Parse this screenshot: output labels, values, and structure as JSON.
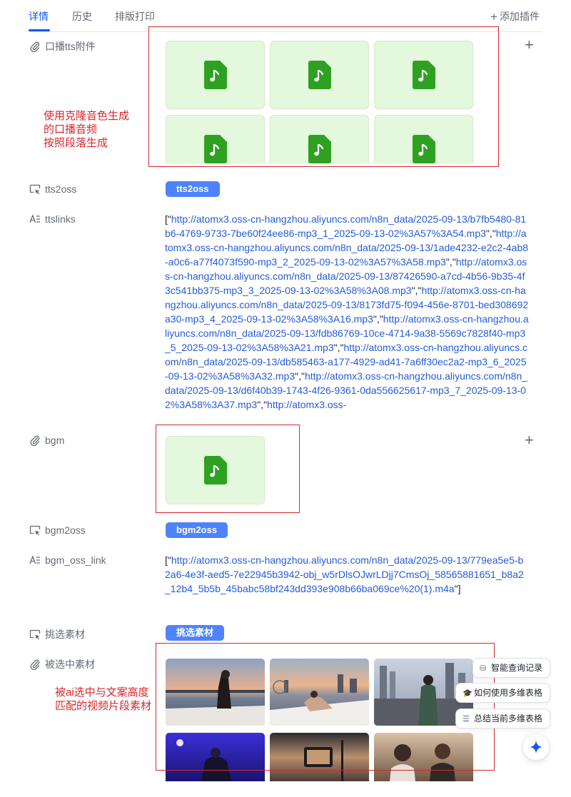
{
  "tabs": {
    "details": "详情",
    "history": "历史",
    "print": "排版打印"
  },
  "add_plugin": "添加插件",
  "fields": {
    "tts_attach": "口播tts附件",
    "tts2oss": "tts2oss",
    "ttslinks": "ttslinks",
    "bgm": "bgm",
    "bgm2oss": "bgm2oss",
    "bgm_oss_link": "bgm_oss_link",
    "select_material": "挑选素材",
    "selected_material": "被选中素材"
  },
  "buttons": {
    "tts2oss": "tts2oss",
    "bgm2oss": "bgm2oss",
    "select_material": "挑选素材"
  },
  "annotations": {
    "tts": [
      "使用克隆音色生成",
      "的口播音频",
      "按照段落生成"
    ],
    "material": [
      "被ai选中与文案高度",
      "匹配的视频片段素材"
    ]
  },
  "ttslinks": {
    "open": "[\"",
    "links": [
      "http://atomx3.oss-cn-hangzhou.aliyuncs.com/n8n_data/2025-09-13/b7fb5480-81b6-4769-9733-7be60f24ee86-mp3_1_2025-09-13-02%3A57%3A54.mp3",
      "http://atomx3.oss-cn-hangzhou.aliyuncs.com/n8n_data/2025-09-13/1ade4232-e2c2-4ab8-a0c6-a77f4073f590-mp3_2_2025-09-13-02%3A57%3A58.mp3",
      "http://atomx3.oss-cn-hangzhou.aliyuncs.com/n8n_data/2025-09-13/87426590-a7cd-4b56-9b35-4f3c541bb375-mp3_3_2025-09-13-02%3A58%3A08.mp3",
      "http://atomx3.oss-cn-hangzhou.aliyuncs.com/n8n_data/2025-09-13/8173fd75-f094-456e-8701-bed308692a30-mp3_4_2025-09-13-02%3A58%3A16.mp3",
      "http://atomx3.oss-cn-hangzhou.aliyuncs.com/n8n_data/2025-09-13/fdb86769-10ce-4714-9a38-5569c7828f40-mp3_5_2025-09-13-02%3A58%3A21.mp3",
      "http://atomx3.oss-cn-hangzhou.aliyuncs.com/n8n_data/2025-09-13/db585463-a177-4929-ad41-7a6ff30ec2a2-mp3_6_2025-09-13-02%3A58%3A32.mp3",
      "http://atomx3.oss-cn-hangzhou.aliyuncs.com/n8n_data/2025-09-13/d6f40b39-1743-4f26-9361-0da556625617-mp3_7_2025-09-13-02%3A58%3A37.mp3",
      "http://atomx3.oss-"
    ],
    "sep": "\",\""
  },
  "bgm_link": {
    "open": "[\"",
    "url": "http://atomx3.oss-cn-hangzhou.aliyuncs.com/n8n_data/2025-09-13/779ea5e5-b2a6-4e3f-aed5-7e22945b3942-obj_w5rDlsOJwrLDjj7CmsOj_58565881651_b8a2_12b4_5b5b_45babc58bf243dd393e908b66ba069ce%20(1).m4a",
    "close": "\"]"
  },
  "floating": {
    "smart_query": "智能查询记录",
    "how_to_use": "如何使用多维表格",
    "summarize": "总结当前多维表格"
  },
  "colors": {
    "accent": "#1456f0",
    "pill": "#4e83fd",
    "link": "#245bdb",
    "tile_bg": "#e3f8dd",
    "file_icon": "#2ea121",
    "annotation": "#d9262a"
  },
  "icons": {
    "attachment": "paperclip-icon",
    "button_field": "cursor-click-icon",
    "text_field": "text-icon",
    "audio_file": "music-file-icon",
    "ai": "sparkle-icon"
  }
}
